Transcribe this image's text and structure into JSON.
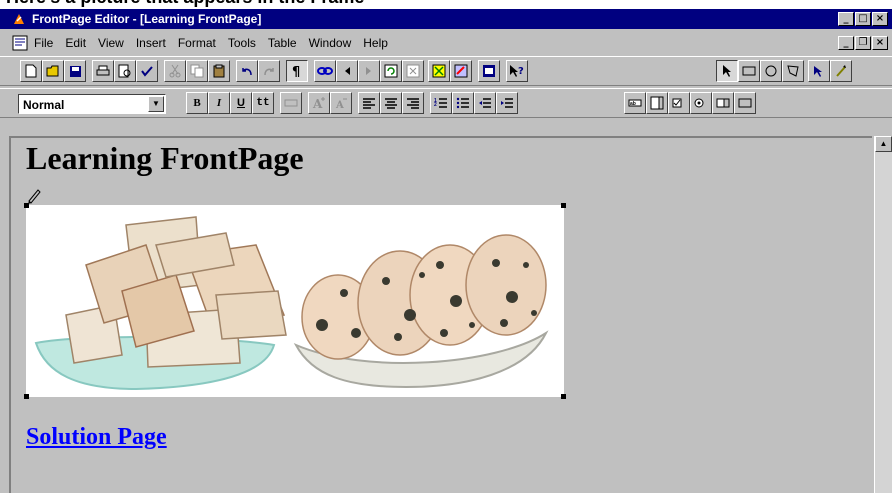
{
  "clipped_caption": "Here's a picture that appears in the Frame",
  "window": {
    "title": "FrontPage Editor - [Learning FrontPage]",
    "controls": {
      "minimize": "_",
      "restore": "□",
      "close": "×"
    }
  },
  "menubar": {
    "items": [
      "File",
      "Edit",
      "View",
      "Insert",
      "Format",
      "Tools",
      "Table",
      "Window",
      "Help"
    ],
    "doc_controls": {
      "minimize": "_",
      "restore": "❐",
      "close": "×"
    }
  },
  "format_toolbar": {
    "style_value": "Normal",
    "bold": "B",
    "italic": "I",
    "underline": "U",
    "typewriter": "tt"
  },
  "document": {
    "heading": "Learning FrontPage",
    "link_text": "Solution Page",
    "link_color": "#0000ff"
  },
  "colors": {
    "titlebar": "#000080",
    "chrome": "#c0c0c0",
    "canvas": "#c0c0c0"
  }
}
